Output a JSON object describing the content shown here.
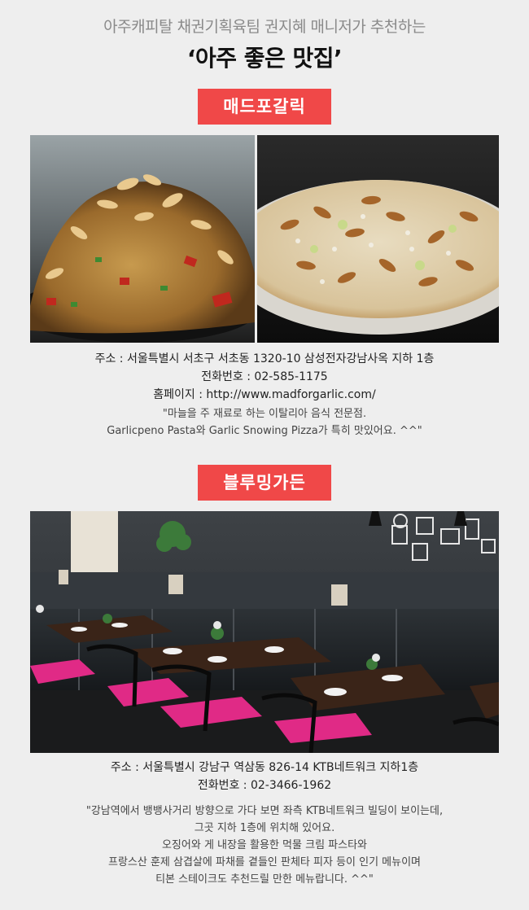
{
  "header": {
    "subtitle": "아주캐피탈 채권기획육팀 권지혜 매니저가 추천하는",
    "title": "‘아주 좋은 맛집’"
  },
  "restaurants": [
    {
      "name": "매드포갈릭",
      "address": "주소 : 서울특별시 서초구 서초동 1320-10 삼성전자강남사옥 지하 1층",
      "phone": "전화번호 : 02-585-1175",
      "homepage": "홈페이지 : http://www.madforgarlic.com/",
      "description": [
        "\"마늘을 주 재료로 하는 이탈리아 음식 전문점.",
        "Garlicpeno Pasta와 Garlic Snowing Pizza가 특히 맛있어요. ^^\""
      ]
    },
    {
      "name": "블루밍가든",
      "address": "주소 : 서울특별시 강남구 역삼동 826-14 KTB네트워크 지하1층",
      "phone": "전화번호 : 02-3466-1962",
      "description": [
        "\"강남역에서 뱅뱅사거리 방향으로 가다 보면 좌측 KTB네트워크 빌딩이 보이는데,",
        "그곳 지하 1층에 위치해 있어요.",
        "오징어와 게 내장을 활용한 먹물 크림 파스타와",
        "프랑스산 훈제 삼겹살에 파채를 곁들인 판체타 피자 등이 인기 메뉴이며",
        "티본 스테이크도 추천드릴 만한 메뉴랍니다. ^^\""
      ]
    }
  ],
  "colors": {
    "badge": "#f04848",
    "background": "#eeeeee"
  }
}
